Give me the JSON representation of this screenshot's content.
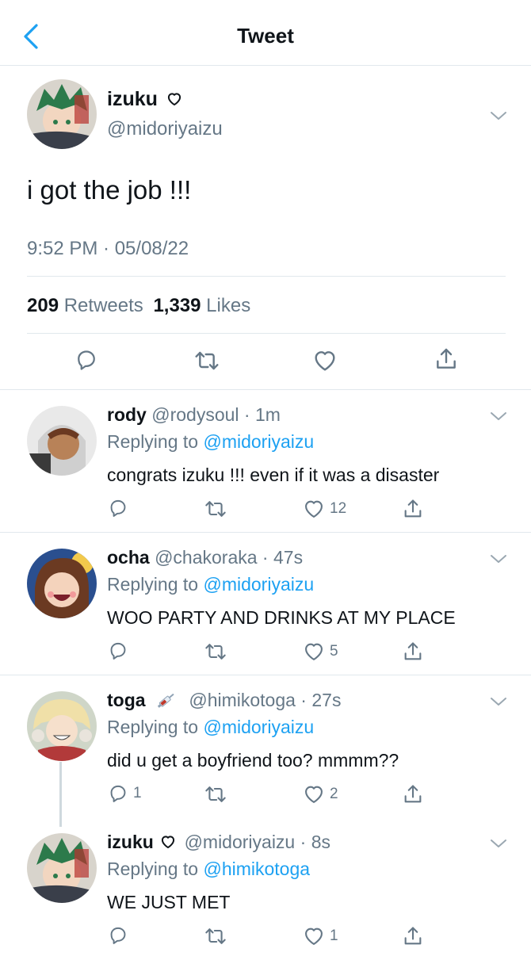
{
  "header": {
    "title": "Tweet"
  },
  "colors": {
    "accent": "#1da1f2",
    "muted": "#657786",
    "text": "#0f1419",
    "divider": "#e1e8ed"
  },
  "main_tweet": {
    "name": "izuku",
    "name_icon": "heart-outline-icon",
    "handle": "@midoriyaizu",
    "text": "i got the job !!!",
    "timestamp": "9:52 PM · 05/08/22",
    "retweets_count": "209",
    "retweets_label": "Retweets",
    "likes_count": "1,339",
    "likes_label": "Likes"
  },
  "replies": [
    {
      "name": "rody",
      "handle": "@rodysoul",
      "time": "1m",
      "replying_prefix": "Replying to",
      "replying_to": "@midoriyaizu",
      "text": "congrats izuku !!! even if it was a disaster",
      "reply_count": "",
      "like_count": "12"
    },
    {
      "name": "ocha",
      "handle": "@chakoraka",
      "time": "47s",
      "replying_prefix": "Replying to",
      "replying_to": "@midoriyaizu",
      "text": "WOO PARTY AND DRINKS AT MY PLACE",
      "reply_count": "",
      "like_count": "5"
    },
    {
      "name": "toga",
      "name_icon": "syringe-icon",
      "handle": "@himikotoga",
      "time": "27s",
      "replying_prefix": "Replying to",
      "replying_to": "@midoriyaizu",
      "text": "did u get a boyfriend too? mmmm??",
      "reply_count": "1",
      "like_count": "2"
    },
    {
      "name": "izuku",
      "name_icon": "heart-outline-icon",
      "handle": "@midoriyaizu",
      "time": "8s",
      "replying_prefix": "Replying to",
      "replying_to": "@himikotoga",
      "text": "WE JUST MET",
      "reply_count": "",
      "like_count": "1"
    }
  ]
}
